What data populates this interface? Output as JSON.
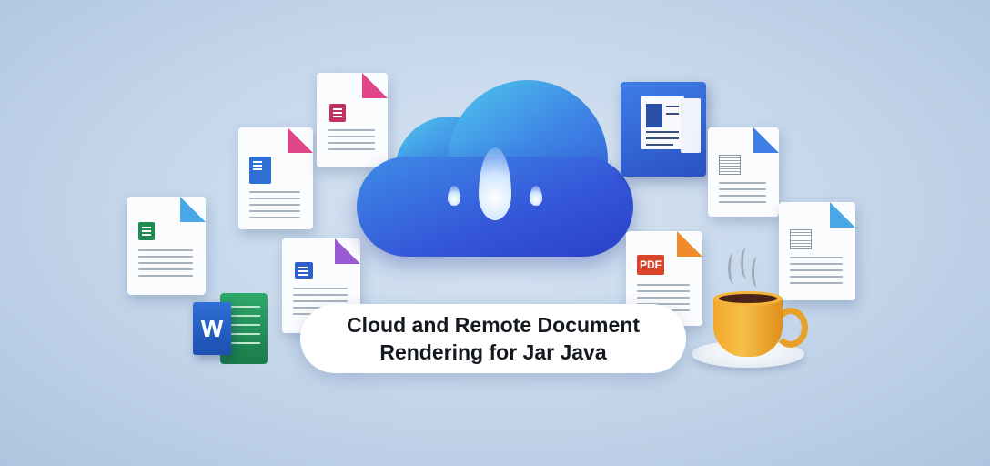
{
  "title": {
    "line1": "Cloud and Remote Document",
    "line2": "Rendering for Jar Java"
  },
  "office_tile": {
    "letter": "W"
  },
  "badges": {
    "pdf": "PDF"
  },
  "colors": {
    "background": "#c3d5ea",
    "cloud_top": "#4fc8ec",
    "cloud_bottom": "#2f4fd6",
    "word_blue": "#2f6fd6",
    "excel_green": "#1f8a52",
    "pdf_red": "#d9452b",
    "pink_accent": "#e0468a",
    "purple_accent": "#9a5cd4",
    "orange_accent": "#f0892a",
    "light_blue_accent": "#4aa8e8",
    "coffee_cup": "#f3a72a"
  },
  "icons": [
    "cloud-icon",
    "water-drop-icon",
    "word-document-icon",
    "excel-document-icon",
    "pdf-document-icon",
    "text-document-icon",
    "office-app-icon",
    "coffee-cup-icon"
  ]
}
